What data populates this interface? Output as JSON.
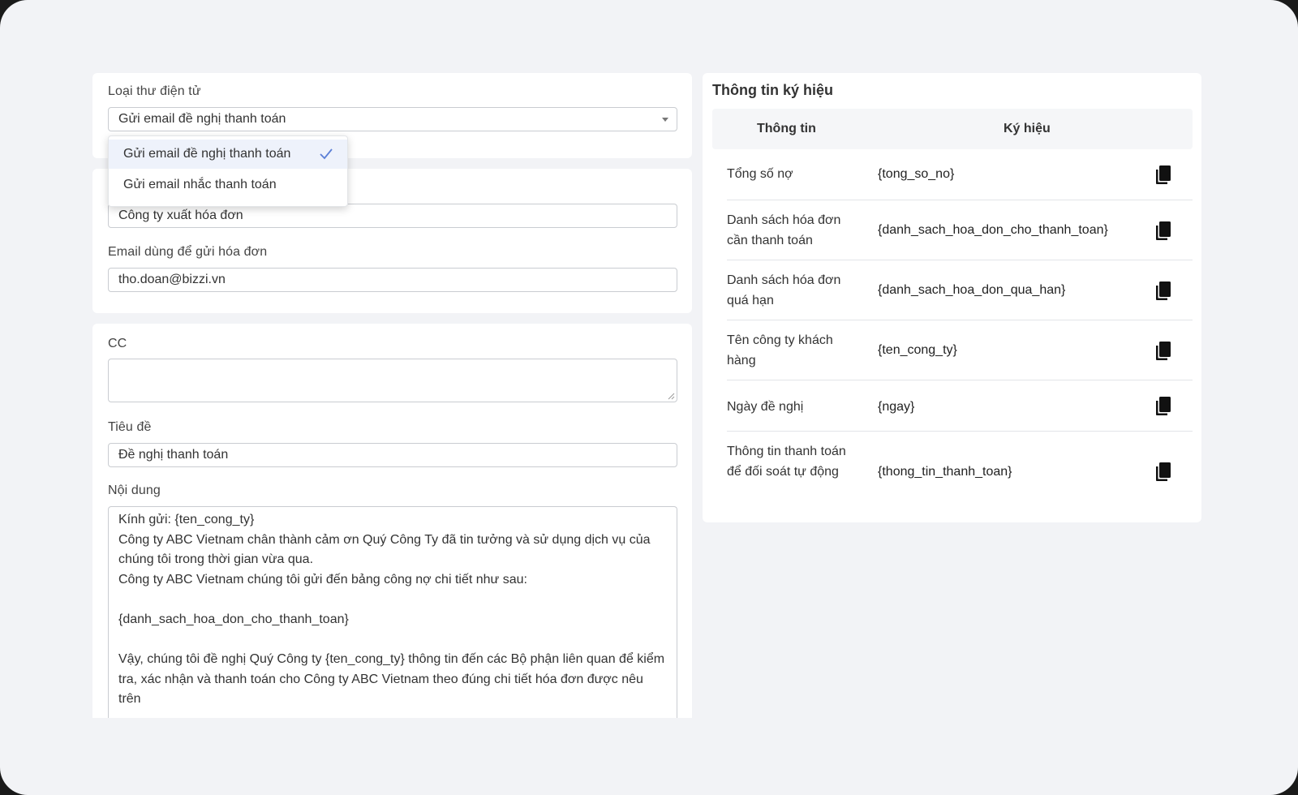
{
  "form": {
    "email_type_label": "Loại thư điện tử",
    "email_type_value": "Gửi email đề nghị thanh toán",
    "dropdown_options": [
      {
        "label": "Gửi email đề nghị thanh toán",
        "selected": true
      },
      {
        "label": "Gửi email nhắc thanh toán",
        "selected": false
      }
    ],
    "company_value": "Công ty xuất hóa đơn",
    "sender_email_label": "Email dùng để gửi hóa đơn",
    "sender_email_value": "tho.doan@bizzi.vn",
    "cc_label": "CC",
    "cc_value": "",
    "subject_label": "Tiêu đề",
    "subject_value": "Đề nghị thanh toán",
    "content_label": "Nội dung",
    "content_value": "Kính gửi: {ten_cong_ty}\nCông ty ABC Vietnam chân thành cảm ơn Quý Công Ty đã tin tưởng và sử dụng dịch vụ của chúng tôi trong thời gian vừa qua.\nCông ty ABC Vietnam chúng tôi gửi đến bảng công nợ chi tiết như sau:\n\n{danh_sach_hoa_don_cho_thanh_toan}\n\nVậy, chúng tôi đề nghị Quý Công ty {ten_cong_ty} thông tin đến các Bộ phận liên quan để kiểm tra, xác nhận và thanh toán cho Công ty ABC Vietnam theo đúng chi tiết hóa đơn được nêu trên"
  },
  "symbols": {
    "title": "Thông tin ký hiệu",
    "col_info": "Thông tin",
    "col_symbol": "Ký hiệu",
    "rows": [
      {
        "info": "Tổng số nợ",
        "symbol": "{tong_so_no}"
      },
      {
        "info": "Danh sách hóa đơn cần thanh toán",
        "symbol": "{danh_sach_hoa_don_cho_thanh_toan}"
      },
      {
        "info": "Danh sách hóa đơn quá hạn",
        "symbol": "{danh_sach_hoa_don_qua_han}"
      },
      {
        "info": "Tên công ty khách hàng",
        "symbol": "{ten_cong_ty}"
      },
      {
        "info": "Ngày đề nghị",
        "symbol": "{ngay}"
      },
      {
        "info": "Thông tin thanh toán để đối soát tự động",
        "symbol": "{thong_tin_thanh_toan}"
      }
    ]
  },
  "icons": {
    "copy": "copy-icon",
    "check": "check-icon",
    "select_arrow": "caret-down-icon"
  },
  "colors": {
    "accent": "#5b7fd6",
    "page_bg": "#f2f3f6"
  }
}
